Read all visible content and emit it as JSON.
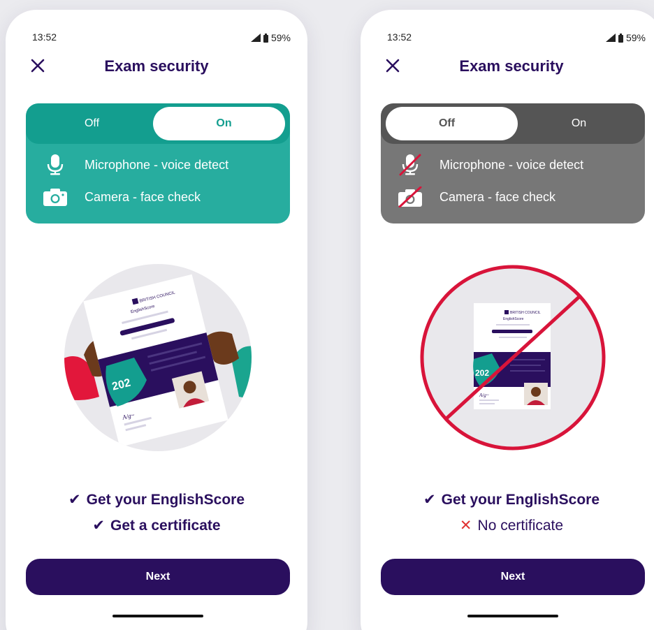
{
  "screens": [
    {
      "status": {
        "time": "13:52",
        "battery": "59%"
      },
      "title": "Exam security",
      "toggle": {
        "off_label": "Off",
        "on_label": "On",
        "selected": "On"
      },
      "features": {
        "microphone": "Microphone - voice detect",
        "camera": "Camera - face check"
      },
      "illustration": {
        "brand": "BRITISH COUNCIL",
        "product": "EnglishScore",
        "badge": "202"
      },
      "outcomes": [
        "Get your EnglishScore",
        "Get a certificate"
      ],
      "outcome_marks": [
        "✔",
        "✔"
      ],
      "next_label": "Next",
      "colors": {
        "card": "#27ad9f",
        "segment": "#139e8f"
      }
    },
    {
      "status": {
        "time": "13:52",
        "battery": "59%"
      },
      "title": "Exam security",
      "toggle": {
        "off_label": "Off",
        "on_label": "On",
        "selected": "Off"
      },
      "features": {
        "microphone": "Microphone - voice detect",
        "camera": "Camera - face check"
      },
      "illustration": {
        "brand": "BRITISH COUNCIL",
        "product": "EnglishScore",
        "badge": "202"
      },
      "outcomes": [
        "Get your EnglishScore",
        "No certificate"
      ],
      "outcome_marks": [
        "✔",
        "✕"
      ],
      "next_label": "Next",
      "colors": {
        "card": "#777777",
        "segment": "#555555",
        "prohibition": "#d8143a"
      }
    }
  ],
  "colors": {
    "primary": "#2a0f5e",
    "background": "#ebebef",
    "cross": "#e03131"
  }
}
